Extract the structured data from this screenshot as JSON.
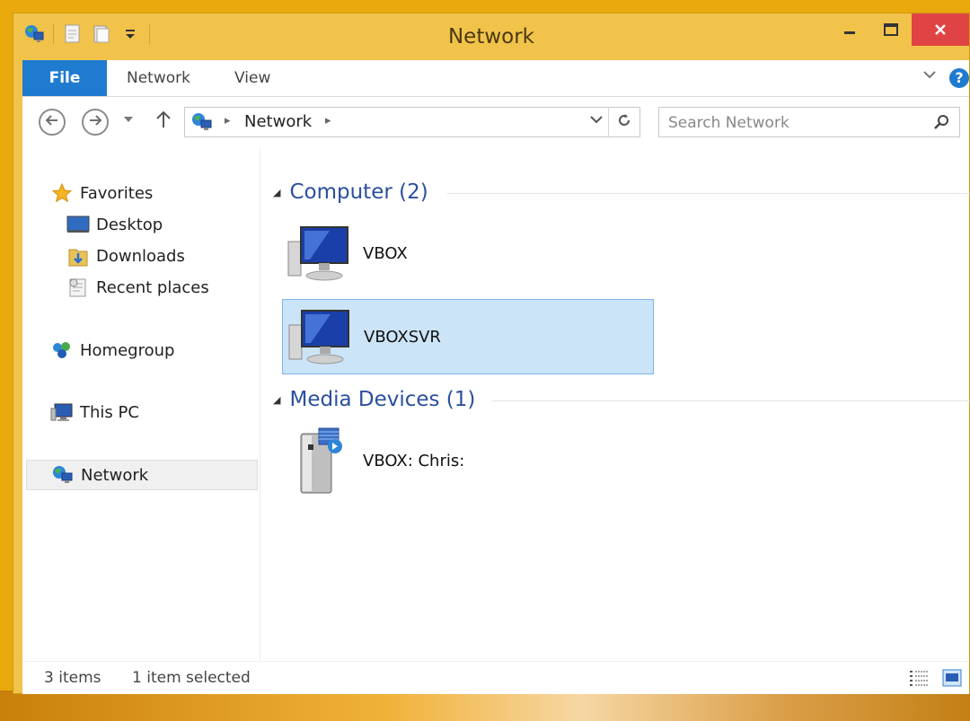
{
  "window": {
    "title": "Network"
  },
  "ribbon": {
    "tabs": [
      "File",
      "Network",
      "View"
    ]
  },
  "navbar": {
    "address_path": "Network",
    "search_placeholder": "Search Network"
  },
  "navpane": {
    "favorites": "Favorites",
    "favorite_items": [
      "Desktop",
      "Downloads",
      "Recent places"
    ],
    "homegroup": "Homegroup",
    "this_pc": "This PC",
    "network": "Network"
  },
  "groups": [
    {
      "title": "Computer (2)",
      "items": [
        "VBOX",
        "VBOXSVR"
      ]
    },
    {
      "title": "Media Devices (1)",
      "items": [
        "VBOX: Chris:"
      ]
    }
  ],
  "status": {
    "count": "3 items",
    "selected": "1 item selected"
  },
  "colors": {
    "accent": "#1f7bd0",
    "frame": "#f2c34a",
    "selection": "#cce4f7",
    "group_title": "#2a4f9e"
  },
  "icons": [
    "network-icon",
    "minimize-icon",
    "maximize-icon",
    "close-icon",
    "help-icon",
    "back-icon",
    "forward-icon",
    "up-icon",
    "refresh-icon",
    "search-icon",
    "star-icon",
    "desktop-icon",
    "downloads-icon",
    "recent-places-icon",
    "homegroup-icon",
    "this-pc-icon",
    "computer-icon",
    "media-device-icon",
    "details-view-icon",
    "large-icons-view-icon"
  ]
}
